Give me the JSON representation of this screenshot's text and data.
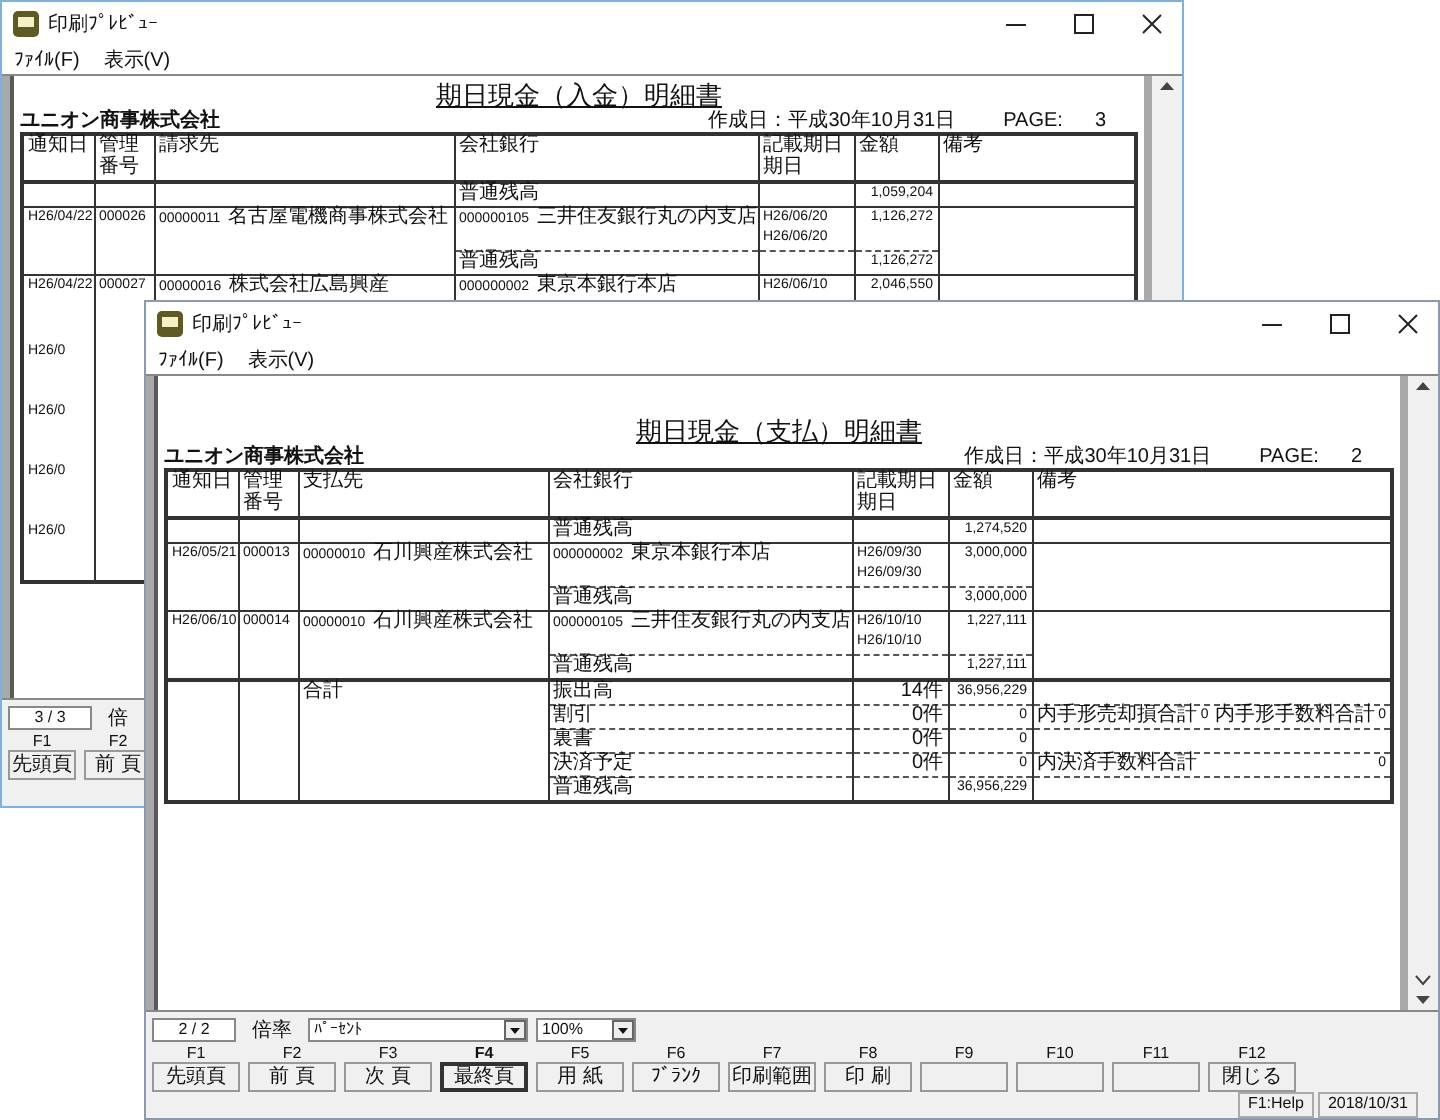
{
  "back_window": {
    "title": "印刷ﾌﾟﾚﾋﾞｭｰ",
    "menu": [
      "ﾌｧｲﾙ(F)",
      "表示(V)"
    ],
    "report": {
      "title": "期日現金（入金）明細書",
      "company": "ユニオン商事株式会社",
      "created": "作成日：平成30年10月31日",
      "page_label": "PAGE:",
      "page_number": "3",
      "columns": [
        {
          "label": "通知日"
        },
        {
          "label": "管理番号"
        },
        {
          "label": "請求先"
        },
        {
          "label": "会社銀行"
        },
        {
          "label": "記載期日",
          "sub": "期日"
        },
        {
          "label": "金額"
        },
        {
          "label": "備考"
        }
      ],
      "opening": {
        "label": "普通残高",
        "amount": "1,059,204"
      },
      "rows": [
        {
          "date": "H26/04/22",
          "number": "000026",
          "party_code": "00000011",
          "party": "名古屋電機商事株式会社",
          "bank_code": "000000105",
          "bank": "三井住友銀行丸の内支店",
          "due": [
            "H26/06/20",
            "H26/06/20"
          ],
          "amount": "1,126,272",
          "balance_label": "普通残高",
          "balance": "1,126,272"
        },
        {
          "date": "H26/04/22",
          "number": "000027",
          "party_code": "00000016",
          "party": "株式会社広島興産",
          "bank_code": "000000002",
          "bank": "東京本銀行本店",
          "due": [
            "H26/06/10"
          ],
          "amount": "2,046,550"
        },
        {
          "date": "H26/0"
        },
        {
          "date": "H26/0"
        },
        {
          "date": "H26/0"
        },
        {
          "date": "H26/0"
        }
      ]
    },
    "page_field": "3 / 3",
    "zoom_label": "倍",
    "keys": [
      {
        "key": "F1",
        "label": "先頭頁",
        "selected": false
      },
      {
        "key": "F2",
        "label": "前 頁",
        "selected": false
      }
    ]
  },
  "front_window": {
    "title": "印刷ﾌﾟﾚﾋﾞｭｰ",
    "menu": [
      "ﾌｧｲﾙ(F)",
      "表示(V)"
    ],
    "report": {
      "title": "期日現金（支払）明細書",
      "company": "ユニオン商事株式会社",
      "created": "作成日：平成30年10月31日",
      "page_label": "PAGE:",
      "page_number": "2",
      "columns": [
        {
          "label": "通知日"
        },
        {
          "label": "管理番号"
        },
        {
          "label": "支払先"
        },
        {
          "label": "会社銀行"
        },
        {
          "label": "記載期日",
          "sub": "期日"
        },
        {
          "label": "金額"
        },
        {
          "label": "備考"
        }
      ],
      "opening": {
        "label": "普通残高",
        "amount": "1,274,520"
      },
      "rows": [
        {
          "date": "H26/05/21",
          "number": "000013",
          "party_code": "00000010",
          "party": "石川興産株式会社",
          "bank_code": "000000002",
          "bank": "東京本銀行本店",
          "due": [
            "H26/09/30",
            "H26/09/30"
          ],
          "amount": "3,000,000",
          "balance_label": "普通残高",
          "balance": "3,000,000"
        },
        {
          "date": "H26/06/10",
          "number": "000014",
          "party_code": "00000010",
          "party": "石川興産株式会社",
          "bank_code": "000000105",
          "bank": "三井住友銀行丸の内支店",
          "due": [
            "H26/10/10",
            "H26/10/10"
          ],
          "amount": "1,227,111",
          "balance_label": "普通残高",
          "balance": "1,227,111"
        }
      ],
      "totals": {
        "label": "合計",
        "lines": [
          {
            "label": "振出高",
            "count": "14件",
            "amount": "36,956,229"
          },
          {
            "label": "割引",
            "count": "0件",
            "amount": "0",
            "notes": [
              {
                "label": "内手形売却損合計",
                "value": "0"
              },
              {
                "label": "内手形手数料合計",
                "value": "0"
              }
            ]
          },
          {
            "label": "裏書",
            "count": "0件",
            "amount": "0"
          },
          {
            "label": "決済予定",
            "count": "0件",
            "amount": "0",
            "notes": [
              {
                "label": "内決済手数料合計",
                "value": "0"
              }
            ]
          },
          {
            "label": "普通残高",
            "amount": "36,956,229"
          }
        ]
      }
    },
    "page_field": "2 / 2",
    "zoom_label": "倍率",
    "zoom_mode": "ﾊﾟｰｾﾝﾄ",
    "zoom_percent": "100%",
    "keys": [
      {
        "key": "F1",
        "label": "先頭頁",
        "selected": false
      },
      {
        "key": "F2",
        "label": "前 頁",
        "selected": false
      },
      {
        "key": "F3",
        "label": "次 頁",
        "selected": false
      },
      {
        "key": "F4",
        "label": "最終頁",
        "selected": true
      },
      {
        "key": "F5",
        "label": "用 紙",
        "selected": false
      },
      {
        "key": "F6",
        "label": "ﾌﾞﾗﾝｸ",
        "selected": false
      },
      {
        "key": "F7",
        "label": "印刷範囲",
        "selected": false
      },
      {
        "key": "F8",
        "label": "印 刷",
        "selected": false
      },
      {
        "key": "F9",
        "selected": false
      },
      {
        "key": "F10",
        "selected": false
      },
      {
        "key": "F11",
        "selected": false
      },
      {
        "key": "F12",
        "label": "閉じる",
        "selected": false
      }
    ],
    "status": [
      "F1:Help",
      "2018/10/31"
    ]
  }
}
